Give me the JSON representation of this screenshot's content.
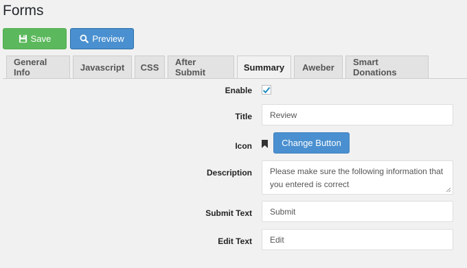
{
  "page": {
    "title": "Forms"
  },
  "toolbar": {
    "save_label": "Save",
    "preview_label": "Preview"
  },
  "tabs": [
    {
      "label": "General Info"
    },
    {
      "label": "Javascript"
    },
    {
      "label": "CSS"
    },
    {
      "label": "After Submit"
    },
    {
      "label": "Summary",
      "active": true
    },
    {
      "label": "Aweber"
    },
    {
      "label": "Smart Donations"
    }
  ],
  "form": {
    "enable_label": "Enable",
    "enable_checked": true,
    "title_label": "Title",
    "title_value": "Review",
    "icon_label": "Icon",
    "icon_name": "bookmark-icon",
    "change_button_label": "Change Button",
    "description_label": "Description",
    "description_value": "Please make sure the following information that you entered is correct",
    "submit_text_label": "Submit Text",
    "submit_text_value": "Submit",
    "edit_text_label": "Edit Text",
    "edit_text_value": "Edit"
  },
  "colors": {
    "save_button": "#5cb85c",
    "primary_button": "#4a90d0",
    "checkmark": "#1e8cbe"
  }
}
